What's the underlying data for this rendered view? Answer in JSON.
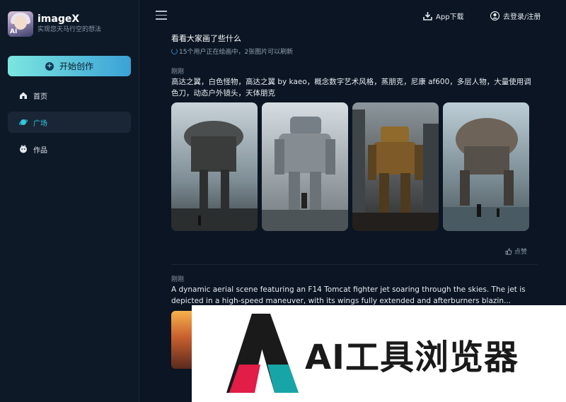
{
  "brand": {
    "title": "imageX",
    "subtitle": "实现您天马行空的想法"
  },
  "sidebar": {
    "create_label": "开始创作",
    "items": [
      {
        "label": "首页",
        "icon": "home-icon",
        "active": false
      },
      {
        "label": "广场",
        "icon": "planet-icon",
        "active": true
      },
      {
        "label": "作品",
        "icon": "works-icon",
        "active": false
      }
    ]
  },
  "header": {
    "app_download": "App下载",
    "login": "去登录/注册"
  },
  "feed": {
    "title": "看看大家画了些什么",
    "status": "15个用户正在绘画中，2张图片可以刷新",
    "posts": [
      {
        "time": "刚刚",
        "prompt": "高达之翼，白色怪物，高达之翼 by kaeo，概念数字艺术风格，蒸朋克，尼康 af600，多层人物，大量使用调色刀，动态户外镜头，天体朋克",
        "like_label": "点赞"
      },
      {
        "time": "刚刚",
        "prompt": "A dynamic aerial scene featuring an F14 Tomcat fighter jet soaring through the skies. The jet is depicted in a high-speed maneuver, with its wings fully extended and afterburners blazin..."
      }
    ]
  },
  "watermark": {
    "text": "AI工具浏览器"
  },
  "colors": {
    "accent": "#33c8de",
    "button_start": "#7ce6e0",
    "button_end": "#3aa2d6",
    "background": "#0b1523"
  }
}
